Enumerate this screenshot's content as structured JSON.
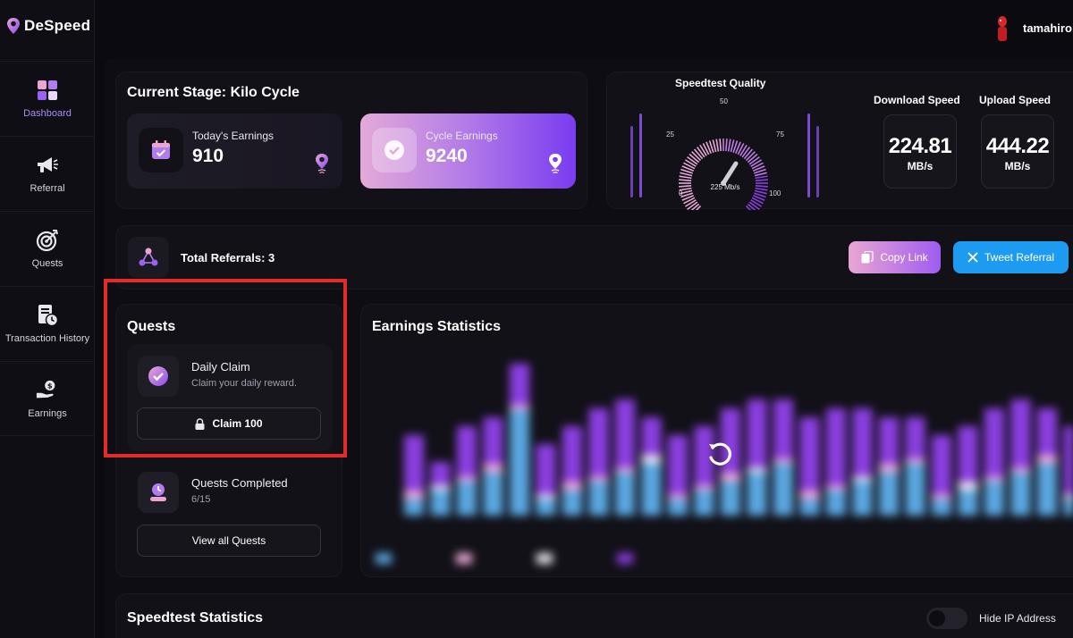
{
  "app": {
    "name": "DeSpeed"
  },
  "user": {
    "name": "tamahiro"
  },
  "sidebar": {
    "items": [
      {
        "label": "Dashboard",
        "icon": "dashboard-icon",
        "active": true
      },
      {
        "label": "Referral",
        "icon": "megaphone-icon"
      },
      {
        "label": "Quests",
        "icon": "target-icon"
      },
      {
        "label": "Transaction History",
        "icon": "receipt-clock-icon"
      },
      {
        "label": "Earnings",
        "icon": "hand-coin-icon"
      }
    ]
  },
  "stage": {
    "title": "Current Stage: Kilo Cycle",
    "today": {
      "label": "Today's Earnings",
      "value": "910"
    },
    "cycle": {
      "label": "Cycle Earnings",
      "value": "9240"
    }
  },
  "speedtest": {
    "title": "Speedtest Quality",
    "gauge": {
      "ticks": [
        "0",
        "25",
        "50",
        "75",
        "100"
      ],
      "reading": "225 Mb/s",
      "level_percent": 62
    },
    "download": {
      "label": "Download Speed",
      "value": "224.81",
      "unit": "MB/s"
    },
    "upload": {
      "label": "Upload Speed",
      "value": "444.22",
      "unit": "MB/s"
    }
  },
  "referrals": {
    "total": "Total Referrals: 3",
    "copy_label": "Copy Link",
    "tweet_label": "Tweet Referral"
  },
  "quests": {
    "title": "Quests",
    "daily": {
      "title": "Daily Claim",
      "subtitle": "Claim your daily reward.",
      "button": "Claim 100"
    },
    "completed": {
      "title": "Quests Completed",
      "progress": "6/15",
      "button": "View all Quests"
    }
  },
  "earnings_stats": {
    "title": "Earnings Statistics",
    "colors": {
      "blue": "#5aa7e0",
      "pink": "#e7a8d6",
      "white": "#e6e2ea",
      "purple": "#8b3fe0"
    }
  },
  "speedtest_stats": {
    "title": "Speedtest Statistics",
    "hide_ip_label": "Hide IP Address"
  },
  "colors": {
    "accent": "#8a4cf0",
    "highlight": "#e42a2a",
    "tweet": "#1d9bf0"
  }
}
